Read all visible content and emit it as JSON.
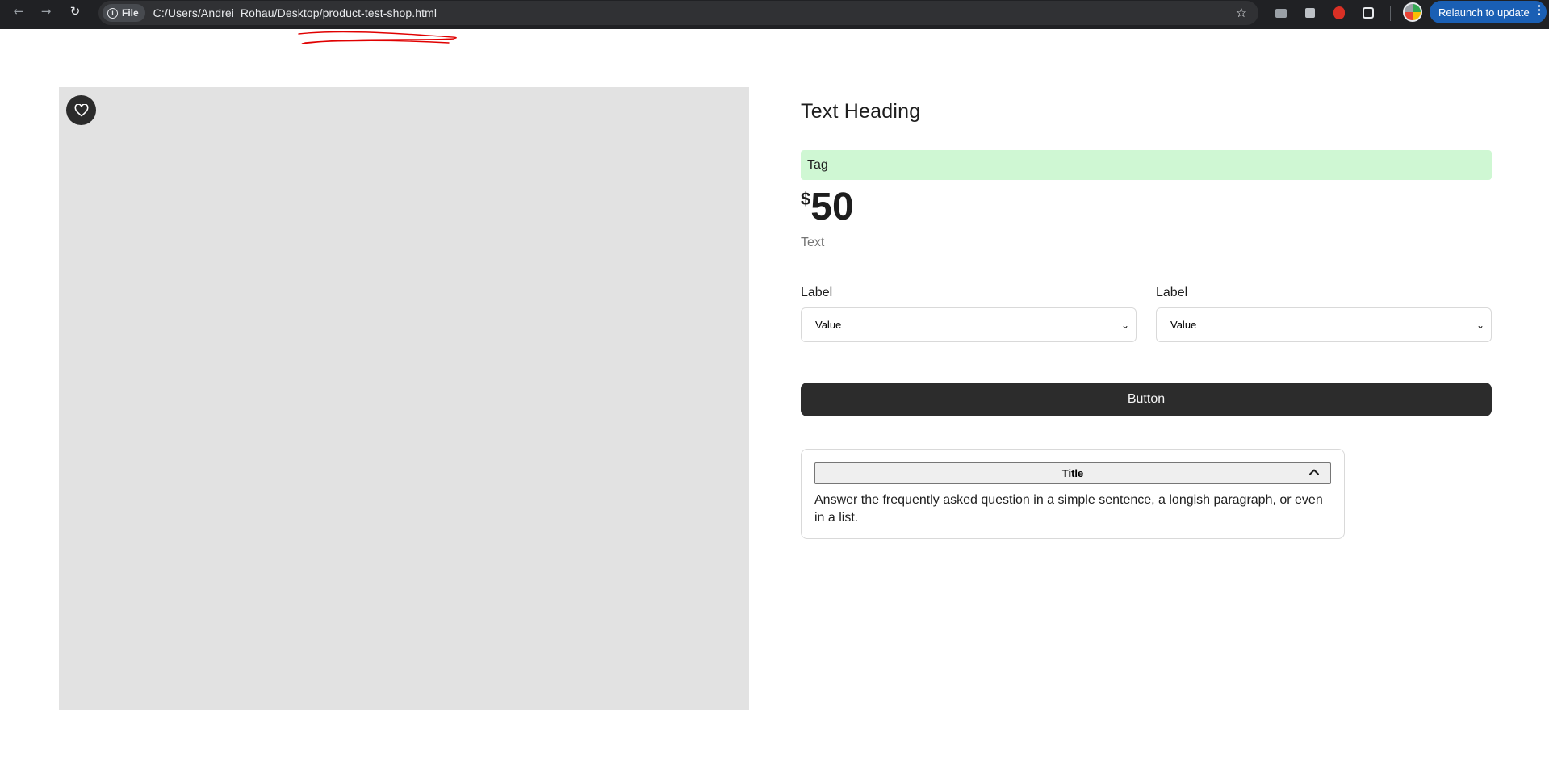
{
  "browser": {
    "chip_label": "File",
    "url": "C:/Users/Andrei_Rohau/Desktop/product-test-shop.html",
    "relaunch_label": "Relaunch to update"
  },
  "product": {
    "heading": "Text Heading",
    "tag": "Tag",
    "currency": "$",
    "price": "50",
    "text": "Text",
    "selects": [
      {
        "label": "Label",
        "value": "Value"
      },
      {
        "label": "Label",
        "value": "Value"
      }
    ],
    "button_label": "Button",
    "accordion": {
      "title": "Title",
      "body": "Answer the frequently asked question in a simple sentence, a longish paragraph, or even in a list."
    }
  },
  "colors": {
    "tag_background": "#cff7d3",
    "button_background": "#2c2c2c",
    "gallery_background": "#e2e2e2",
    "annotation": "#e00000"
  },
  "icons": [
    "back-icon",
    "forward-icon",
    "reload-icon",
    "info-icon",
    "star-icon",
    "heart-icon",
    "chevron-down-icon",
    "chevron-up-icon",
    "more-icon"
  ]
}
